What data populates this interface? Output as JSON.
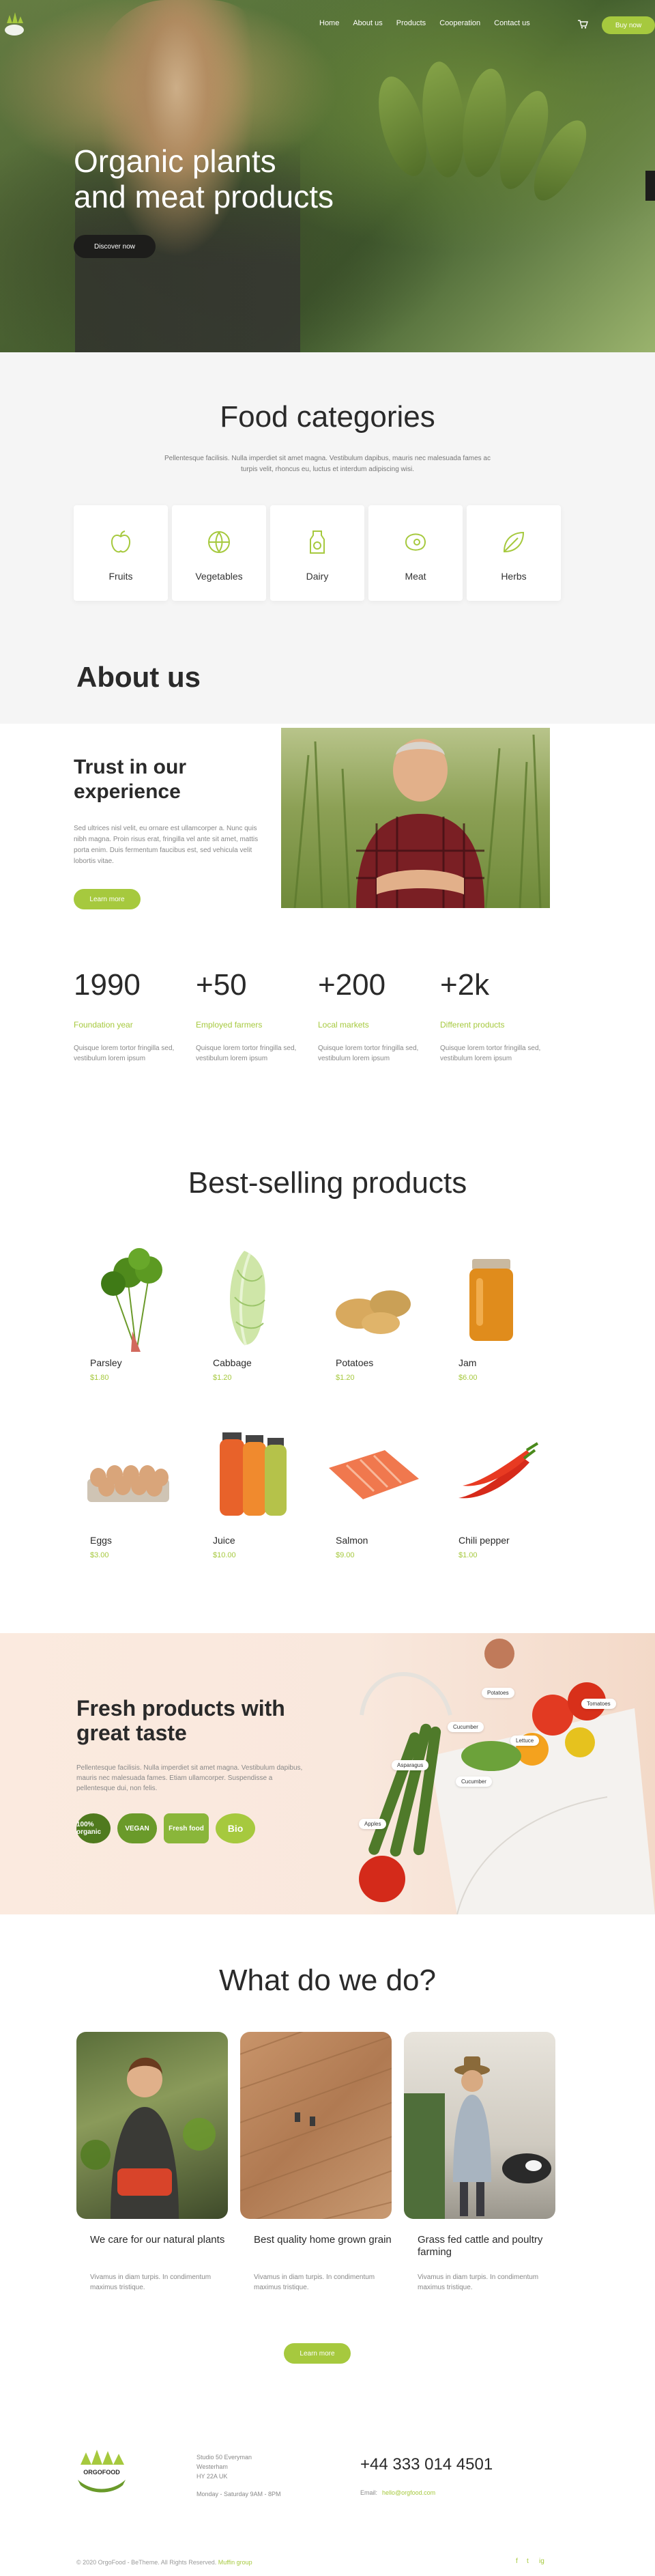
{
  "colors": {
    "accent": "#a6c93e",
    "dark": "#1d1d1b",
    "text": "#2a2a2a",
    "muted": "#888888"
  },
  "nav": {
    "items": [
      "Home",
      "About us",
      "Products",
      "Cooperation",
      "Contact us"
    ],
    "buy_label": "Buy now"
  },
  "hero": {
    "title_line1": "Organic plants",
    "title_line2": "and meat products",
    "button": "Discover now"
  },
  "categories": {
    "title": "Food categories",
    "subtitle": "Pellentesque facilisis. Nulla imperdiet sit amet magna. Vestibulum dapibus, mauris nec malesuada fames ac turpis velit, rhoncus eu, luctus et interdum adipiscing wisi.",
    "items": [
      {
        "label": "Fruits",
        "icon": "apple-icon"
      },
      {
        "label": "Vegetables",
        "icon": "cabbage-icon"
      },
      {
        "label": "Dairy",
        "icon": "milk-icon"
      },
      {
        "label": "Meat",
        "icon": "steak-icon"
      },
      {
        "label": "Herbs",
        "icon": "leaf-icon"
      }
    ]
  },
  "about": {
    "title": "About us",
    "trust_title_line1": "Trust in our",
    "trust_title_line2": "experience",
    "text": "Sed ultrices nisl velit, eu ornare est ullamcorper a. Nunc quis nibh magna. Proin risus erat, fringilla vel ante sit amet, mattis porta enim. Duis fermentum faucibus est, sed vehicula velit lobortis vitae.",
    "button": "Learn more"
  },
  "stats": [
    {
      "number": "1990",
      "label": "Foundation year",
      "text": "Quisque lorem tortor fringilla sed, vestibulum lorem ipsum"
    },
    {
      "number": "+50",
      "label": "Employed farmers",
      "text": "Quisque lorem tortor fringilla sed, vestibulum lorem ipsum"
    },
    {
      "number": "+200",
      "label": "Local markets",
      "text": "Quisque lorem tortor fringilla sed, vestibulum lorem ipsum"
    },
    {
      "number": "+2k",
      "label": "Different products",
      "text": "Quisque lorem tortor fringilla sed, vestibulum lorem ipsum"
    }
  ],
  "products": {
    "title": "Best-selling products",
    "items": [
      {
        "name": "Parsley",
        "price": "$1.80"
      },
      {
        "name": "Cabbage",
        "price": "$1.20"
      },
      {
        "name": "Potatoes",
        "price": "$1.20"
      },
      {
        "name": "Jam",
        "price": "$6.00"
      },
      {
        "name": "Eggs",
        "price": "$3.00"
      },
      {
        "name": "Juice",
        "price": "$10.00"
      },
      {
        "name": "Salmon",
        "price": "$9.00"
      },
      {
        "name": "Chili pepper",
        "price": "$1.00"
      }
    ]
  },
  "fresh": {
    "title_line1": "Fresh products with",
    "title_line2": "great taste",
    "text": "Pellentesque facilisis. Nulla imperdiet sit amet magna. Vestibulum dapibus, mauris nec malesuada fames. Etiam ullamcorper. Suspendisse a pellentesque dui, non felis.",
    "badges": [
      "100% organic",
      "VEGAN",
      "Fresh food",
      "Bio"
    ],
    "tags": [
      "Potatoes",
      "Tomatoes",
      "Cucumber",
      "Lettuce",
      "Asparagus",
      "Cucumber",
      "Apples"
    ]
  },
  "what": {
    "title": "What do we do?",
    "cards": [
      {
        "title": "We care for our natural plants",
        "text": "Vivamus in diam turpis. In condimentum maximus tristique."
      },
      {
        "title": "Best quality home grown grain",
        "text": "Vivamus in diam turpis. In condimentum maximus tristique."
      },
      {
        "title": "Grass fed cattle and poultry farming",
        "text": "Vivamus in diam turpis. In condimentum maximus tristique."
      }
    ],
    "button": "Learn more"
  },
  "footer": {
    "logo_text": "ORGOFOOD",
    "address_line1": "Studio 50 Everyman",
    "address_line2": "Westerham",
    "address_line3": "HY 22A UK",
    "hours": "Monday - Saturday 9AM - 8PM",
    "phone": "+44 333 014 4501",
    "email_label": "Email:",
    "email": "hello@orgfood.com",
    "copyright": "© 2020 OrgoFood - BeTheme. All Rights Reserved.",
    "copyright_link": "Muffin group",
    "social": [
      "f",
      "t",
      "ig"
    ]
  }
}
